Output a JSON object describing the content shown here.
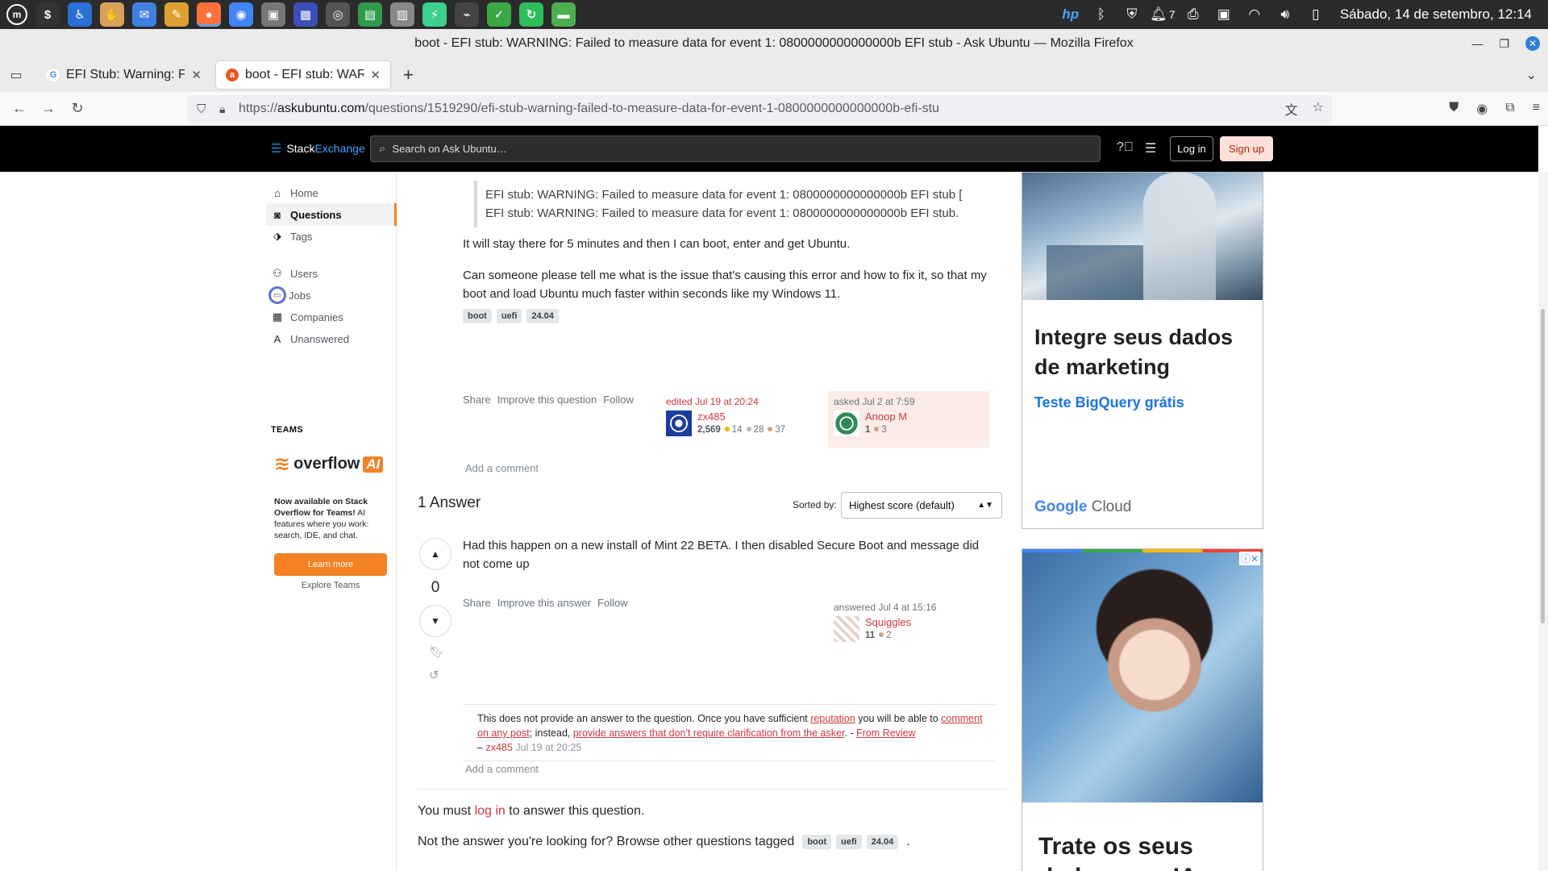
{
  "os": {
    "clock": "Sábado, 14 de setembro, 12:14",
    "notifications": "7",
    "apps": [
      {
        "name": "terminal",
        "color": "#333333",
        "glyph": "$"
      },
      {
        "name": "accessibility",
        "color": "#2a6fd6",
        "glyph": "♿"
      },
      {
        "name": "hand",
        "color": "#d9a25a",
        "glyph": "✋"
      },
      {
        "name": "mail",
        "color": "#3f7fe0",
        "glyph": "✉"
      },
      {
        "name": "notes",
        "color": "#e0a030",
        "glyph": "✎"
      },
      {
        "name": "firefox",
        "color": "#ff7139",
        "glyph": "●"
      },
      {
        "name": "chrome",
        "color": "#4285f4",
        "glyph": "◉"
      },
      {
        "name": "cube",
        "color": "#777777",
        "glyph": "▣"
      },
      {
        "name": "monitor",
        "color": "#3b4fb8",
        "glyph": "▦"
      },
      {
        "name": "eye",
        "color": "#555555",
        "glyph": "◎"
      },
      {
        "name": "spreadsheet",
        "color": "#2e9a4a",
        "glyph": "▤"
      },
      {
        "name": "package",
        "color": "#888888",
        "glyph": "▥"
      },
      {
        "name": "bolt",
        "color": "#3ccf8e",
        "glyph": "⚡"
      },
      {
        "name": "usb",
        "color": "#444444",
        "glyph": "⌁"
      },
      {
        "name": "keyring",
        "color": "#3aa845",
        "glyph": "✓"
      },
      {
        "name": "refresh",
        "color": "#2dbd5a",
        "glyph": "↻"
      },
      {
        "name": "files",
        "color": "#4caf50",
        "glyph": "▬"
      }
    ]
  },
  "window": {
    "title": "boot - EFI stub: WARNING: Failed to measure data for event 1: 0800000000000000b EFI stub - Ask Ubuntu — Mozilla Firefox"
  },
  "tabs": [
    {
      "label": "EFI Stub: Warning: Faile",
      "favicon": "G",
      "color": "#ffffff",
      "fg": "#4285f4",
      "selected": false
    },
    {
      "label": "boot - EFI stub: WARNII",
      "favicon": "a",
      "color": "#e95420",
      "fg": "#ffffff",
      "selected": true
    }
  ],
  "url": {
    "prefix": "https://",
    "domain": "askubuntu.com",
    "path": "/questions/1519290/efi-stub-warning-failed-to-measure-data-for-event-1-0800000000000000b-efi-stu"
  },
  "se": {
    "brand_a": "Stack",
    "brand_b": "Exchange",
    "search_placeholder": "Search on Ask Ubuntu…",
    "login": "Log in",
    "signup": "Sign up"
  },
  "nav": {
    "items": [
      {
        "label": "Home",
        "icon": "⌂"
      },
      {
        "label": "Questions",
        "icon": "◙"
      },
      {
        "label": "Tags",
        "icon": "⬗"
      },
      {
        "label": "Users",
        "icon": "⚇"
      },
      {
        "label": "Jobs",
        "icon": "▭"
      },
      {
        "label": "Companies",
        "icon": "▦"
      },
      {
        "label": "Unanswered",
        "icon": "A"
      }
    ],
    "teams_heading": "TEAMS",
    "overflow_brand": "overflow",
    "overflow_ai": "AI",
    "teams_text_bold": "Now available on Stack Overflow for Teams!",
    "teams_text": " AI features where you work: search, IDE, and chat.",
    "learn_more": "Learn more",
    "explore_teams": "Explore Teams"
  },
  "question": {
    "quote_line1": "EFI stub: WARNING: Failed to measure data for event 1: 0800000000000000b EFI stub [",
    "quote_line2": "EFI stub: WARNING: Failed to measure data for event 1: 0800000000000000b EFI stub.",
    "para1": "It will stay there for 5 minutes and then I can boot, enter and get Ubuntu.",
    "para2": "Can someone please tell me what is the issue that's causing this error and how to fix it, so that my boot and load Ubuntu much faster within seconds like my Windows 11.",
    "tags": [
      "boot",
      "uefi",
      "24.04"
    ],
    "actions": [
      "Share",
      "Improve this question",
      "Follow"
    ],
    "edited": {
      "when": "edited Jul 19 at 20:24",
      "name": "zx485",
      "rep": "2,569",
      "gold": "14",
      "silver": "28",
      "bronze": "37"
    },
    "asked": {
      "when": "asked Jul 2 at 7:59",
      "name": "Anoop M",
      "rep": "1",
      "bronze": "3"
    },
    "add_comment": "Add a comment"
  },
  "answers": {
    "heading": "1 Answer",
    "sorted_by": "Sorted by:",
    "sort_value": "Highest score (default)",
    "answer": {
      "score": "0",
      "text": "Had this happen on a new install of Mint 22 BETA. I then disabled Secure Boot and message did not come up",
      "actions": [
        "Share",
        "Improve this answer",
        "Follow"
      ],
      "answered": {
        "when": "answered Jul 4 at 15:16",
        "name": "Squiggles",
        "rep": "11",
        "bronze": "2"
      }
    },
    "comment": {
      "t1": "This does not provide an answer to the question. Once you have sufficient ",
      "l1": "reputation",
      "t2": " you will be able to ",
      "l2": "comment on any post",
      "t3": "; instead, ",
      "l3": "provide answers that don't require clarification from the asker",
      "t4": ". - ",
      "l4": "From Review",
      "dash": "– ",
      "user": "zx485",
      "date": "Jul 19 at 20:25"
    },
    "add_comment": "Add a comment"
  },
  "footer": {
    "must_a": "You must ",
    "must_link": "log in",
    "must_b": " to answer this question.",
    "notans": "Not the answer you're looking for? Browse other questions tagged",
    "tags": [
      "boot",
      "uefi",
      "24.04"
    ],
    "period": "."
  },
  "ads": {
    "ad1_headline": "Integre seus dados de marketing",
    "ad1_sub": "Teste BigQuery grátis",
    "ad1_brand_a": "Google",
    "ad1_brand_b": " Cloud",
    "ad2_headline": "Trate os seus dados com IA"
  }
}
